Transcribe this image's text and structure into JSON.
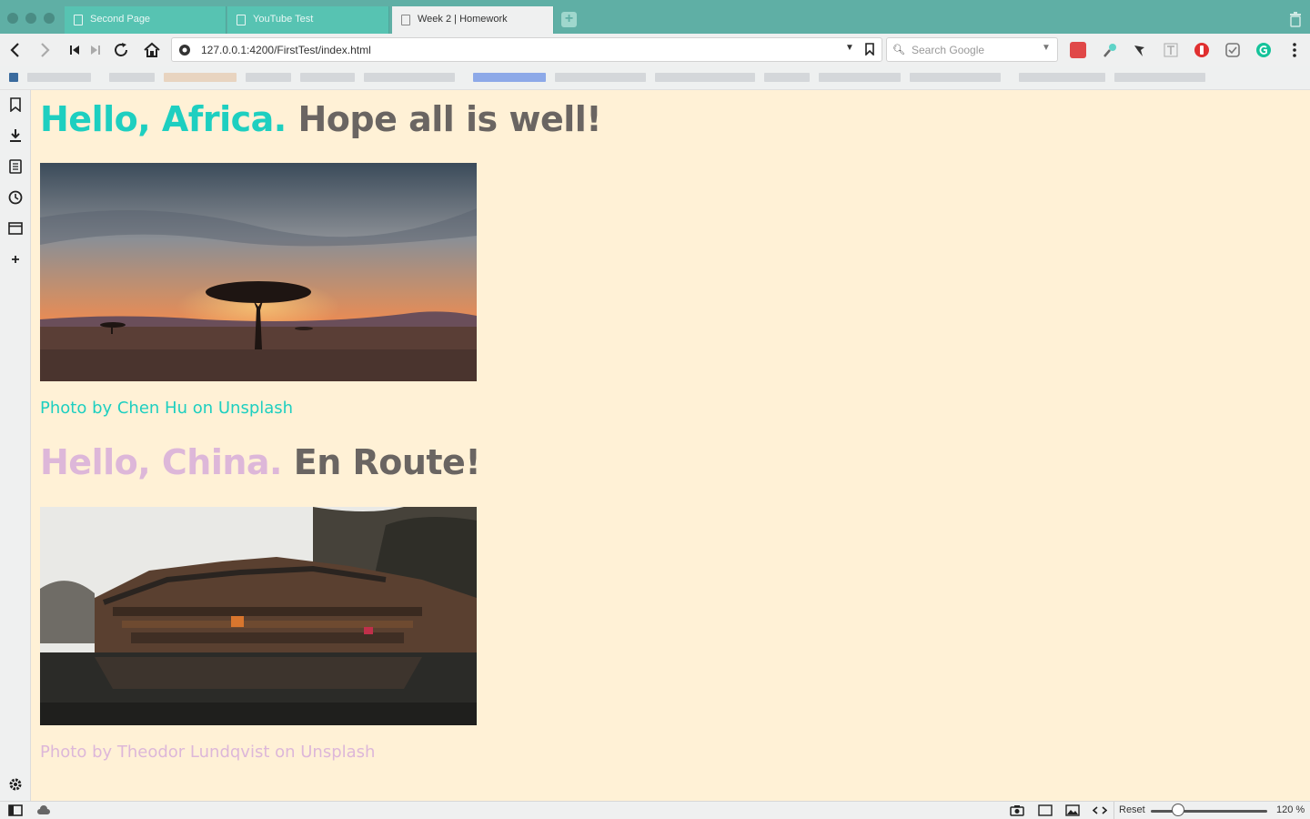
{
  "browser": {
    "tabs": [
      {
        "title": "Second Page",
        "active": false
      },
      {
        "title": "YouTube Test",
        "active": false
      },
      {
        "title": "Week 2 | Homework",
        "active": true
      }
    ],
    "url": "127.0.0.1:4200/FirstTest/index.html",
    "search_placeholder": "Search Google",
    "status": {
      "reset_label": "Reset",
      "zoom_label": "120 %",
      "zoom_level": 120
    }
  },
  "page": {
    "colors": {
      "teal": "#1ecfc0",
      "lilac": "#ddb7d9",
      "gray": "#6a6562",
      "background": "#fff1d6"
    },
    "sections": [
      {
        "greeting": "Hello, Africa.",
        "tagline": "Hope all is well!",
        "caption": "Photo by Chen Hu on Unsplash",
        "image": "savanna-sunset-acacia-photo"
      },
      {
        "greeting": "Hello, China.",
        "tagline": "En Route!",
        "caption": "Photo by Theodor Lundqvist on Unsplash",
        "image": "riverside-wooden-houses-photo"
      }
    ]
  }
}
